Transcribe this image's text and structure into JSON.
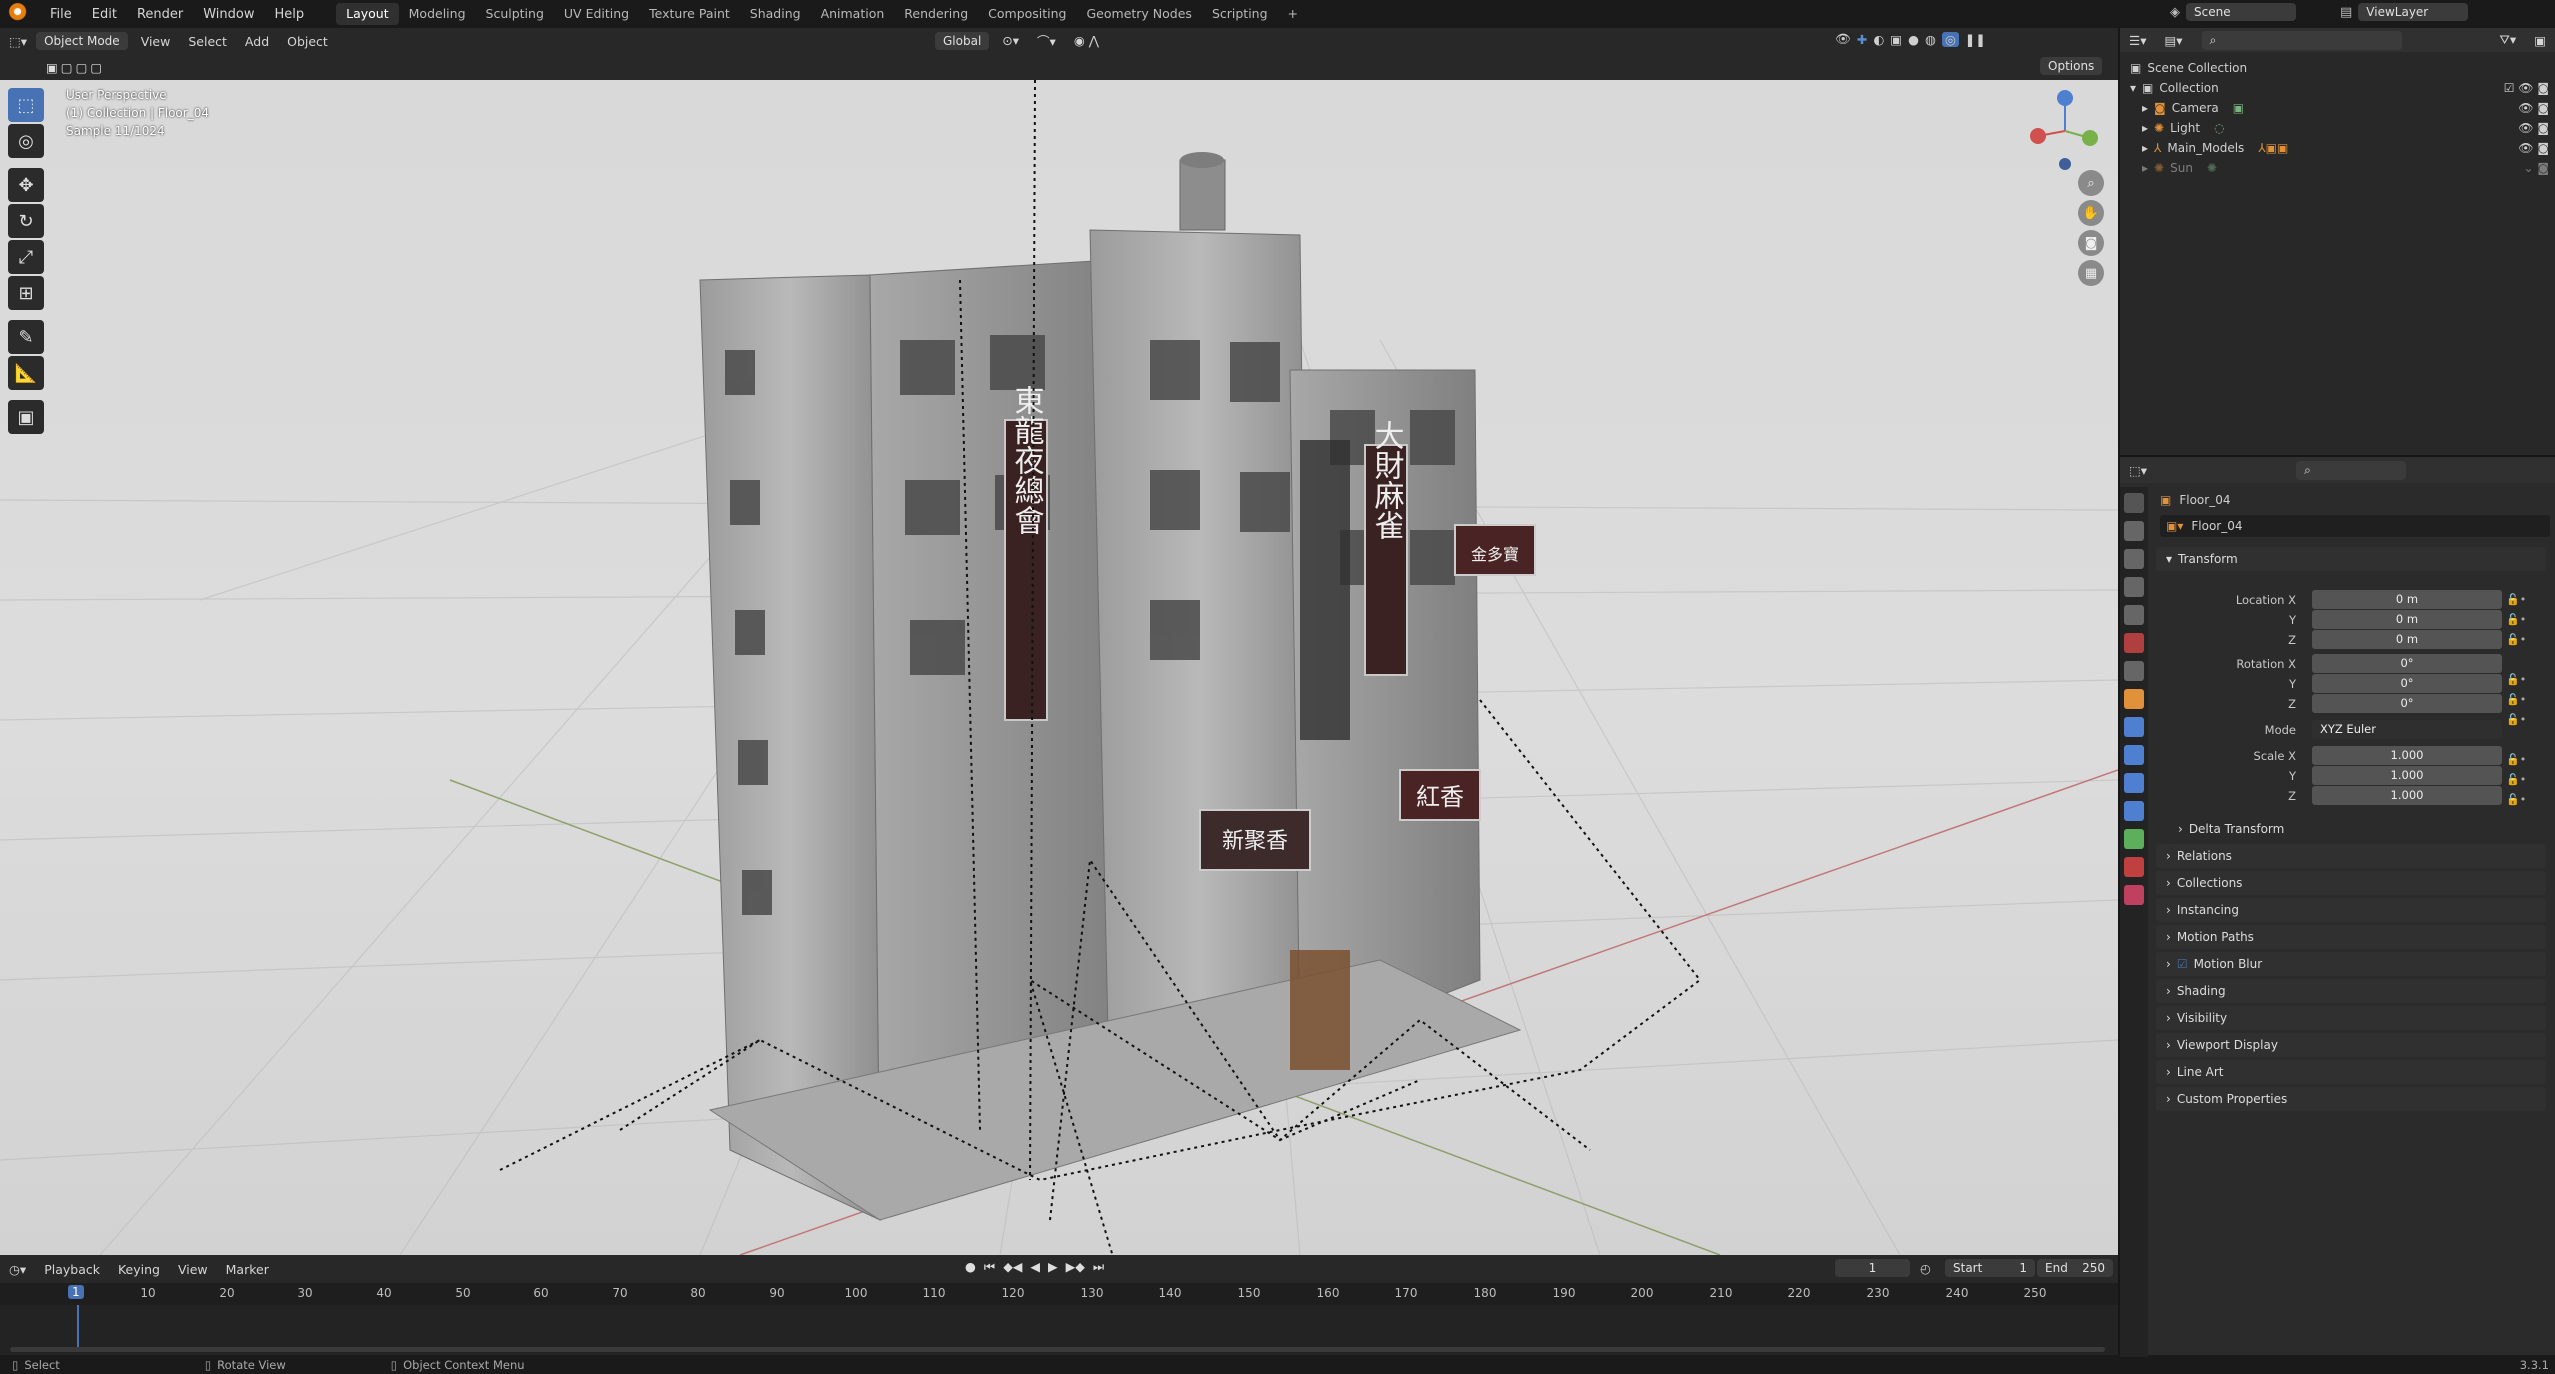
{
  "menu": [
    "File",
    "Edit",
    "Render",
    "Window",
    "Help"
  ],
  "workspaces": [
    "Layout",
    "Modeling",
    "Sculpting",
    "UV Editing",
    "Texture Paint",
    "Shading",
    "Animation",
    "Rendering",
    "Compositing",
    "Geometry Nodes",
    "Scripting"
  ],
  "active_workspace": "Layout",
  "scene": {
    "label": "Scene",
    "view_layer": "ViewLayer"
  },
  "viewport_header": {
    "mode": "Object Mode",
    "menus": [
      "View",
      "Select",
      "Add",
      "Object"
    ],
    "orientation": "Global",
    "options": "Options"
  },
  "viewport_overlay": {
    "line1": "User Perspective",
    "line2": "(1) Collection | Floor_04",
    "line3": "Sample 11/1024"
  },
  "timeline": {
    "menus": [
      "Playback",
      "Keying",
      "View",
      "Marker"
    ],
    "current_frame": "1",
    "start_label": "Start",
    "start": "1",
    "end_label": "End",
    "end": "250",
    "ticks": [
      "10",
      "20",
      "30",
      "40",
      "50",
      "60",
      "70",
      "80",
      "90",
      "100",
      "110",
      "120",
      "130",
      "140",
      "150",
      "160",
      "170",
      "180",
      "190",
      "200",
      "210",
      "220",
      "230",
      "240",
      "250"
    ],
    "marker": "1"
  },
  "status": {
    "select": "Select",
    "rotate": "Rotate View",
    "context": "Object Context Menu",
    "version": "3.3.1"
  },
  "outliner": {
    "root": "Scene Collection",
    "collection": "Collection",
    "items": [
      "Camera",
      "Light",
      "Main_Models",
      "Sun"
    ]
  },
  "properties": {
    "object_name": "Floor_04",
    "data_name": "Floor_04",
    "transform": "Transform",
    "location_x_label": "Location X",
    "loc_y_label": "Y",
    "loc_z_label": "Z",
    "location": [
      "0 m",
      "0 m",
      "0 m"
    ],
    "rotation_x_label": "Rotation X",
    "rot_y_label": "Y",
    "rot_z_label": "Z",
    "rotation": [
      "0°",
      "0°",
      "0°"
    ],
    "mode_label": "Mode",
    "mode": "XYZ Euler",
    "scale_x_label": "Scale X",
    "scale_y_label": "Y",
    "scale_z_label": "Z",
    "scale": [
      "1.000",
      "1.000",
      "1.000"
    ],
    "delta": "Delta Transform",
    "panels": [
      "Relations",
      "Collections",
      "Instancing",
      "Motion Paths",
      "Motion Blur",
      "Shading",
      "Visibility",
      "Viewport Display",
      "Line Art",
      "Custom Properties"
    ]
  },
  "signs": [
    "東龍夜總會",
    "大財麻雀",
    "金多寶",
    "紅香",
    "新聚香"
  ]
}
